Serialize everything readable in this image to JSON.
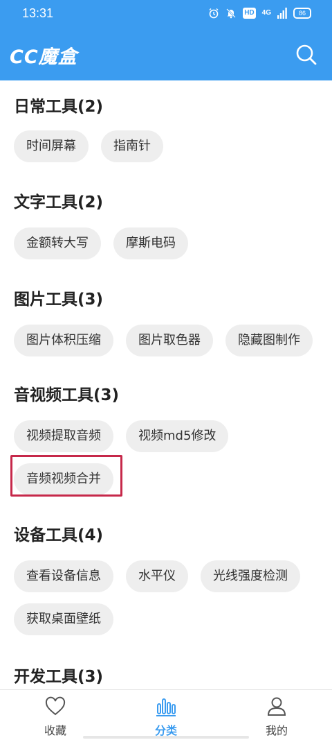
{
  "status_bar": {
    "time": "13:31",
    "hd": "HD",
    "network": "4G",
    "battery": "86"
  },
  "app_bar": {
    "title": "CC魔盒",
    "search_icon": "search-icon",
    "background_color": "#3b9cf0"
  },
  "sections": [
    {
      "title": "日常工具(2)",
      "tools": [
        "时间屏幕",
        "指南针"
      ]
    },
    {
      "title": "文字工具(2)",
      "tools": [
        "金额转大写",
        "摩斯电码"
      ]
    },
    {
      "title": "图片工具(3)",
      "tools": [
        "图片体积压缩",
        "图片取色器",
        "隐藏图制作"
      ]
    },
    {
      "title": "音视频工具(3)",
      "tools": [
        "视频提取音频",
        "视频md5修改",
        "音频视频合并"
      ]
    },
    {
      "title": "设备工具(4)",
      "tools": [
        "查看设备信息",
        "水平仪",
        "光线强度检测",
        "获取桌面壁纸"
      ]
    },
    {
      "title": "开发工具(3)"
    }
  ],
  "highlighted_tool": "音频视频合并",
  "bottom_nav": {
    "items": [
      {
        "label": "收藏",
        "icon": "heart-icon",
        "active": false
      },
      {
        "label": "分类",
        "icon": "category-bars-icon",
        "active": true
      },
      {
        "label": "我的",
        "icon": "user-icon",
        "active": false
      }
    ],
    "active_color": "#3b9cf0"
  }
}
